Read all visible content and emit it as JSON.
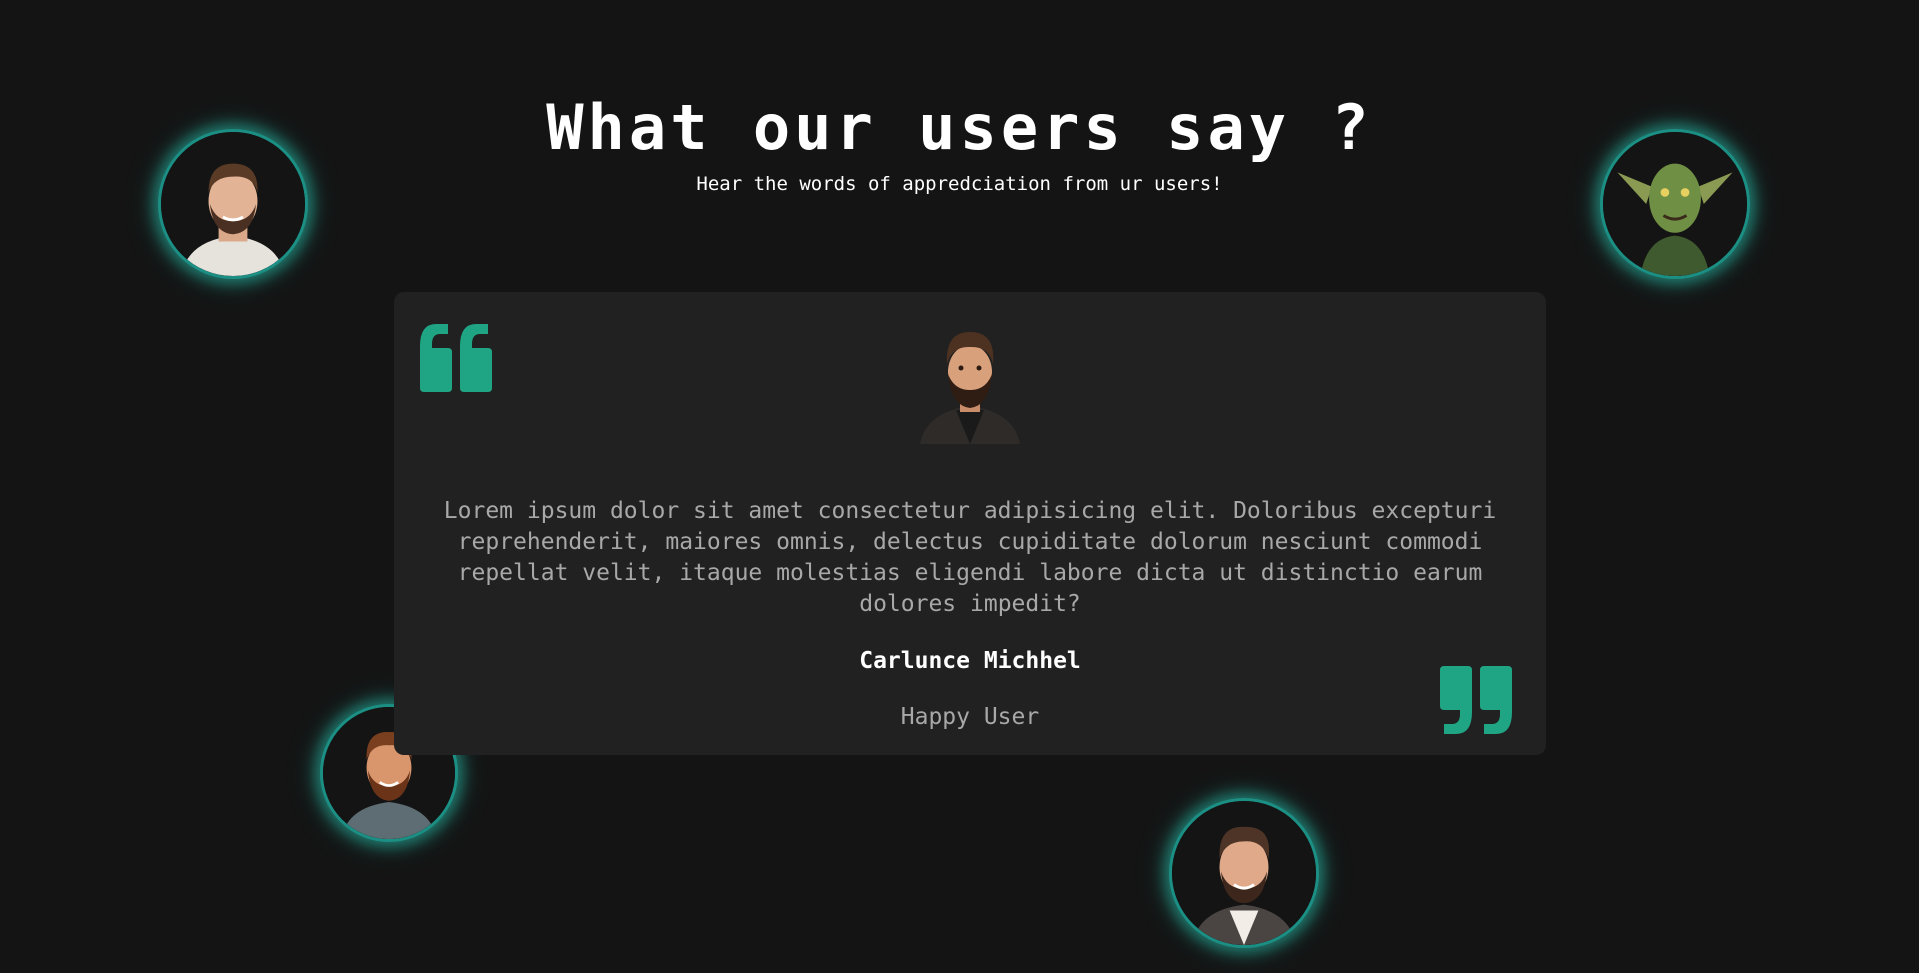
{
  "header": {
    "title": "What our users say ?",
    "subtitle": "Hear the words of appredciation from ur users!"
  },
  "testimonial": {
    "avatar": "bearded-man-avatar",
    "text": "Lorem ipsum dolor sit amet consectetur adipisicing elit. Doloribus excepturi reprehenderit, maiores omnis, delectus cupiditate dolorum nesciunt commodi repellat velit, itaque molestias eligendi labore dicta ut distinctio earum dolores impedit?",
    "name": "Carlunce Michhel",
    "role": "Happy User"
  },
  "user_avatars": [
    {
      "icon": "smiling-man-avatar"
    },
    {
      "icon": "goblin-avatar"
    },
    {
      "icon": "bearded-man-avatar"
    },
    {
      "icon": "smiling-man-jacket-avatar"
    }
  ],
  "colors": {
    "background": "#141414",
    "card": "#212121",
    "accent": "#1fa584",
    "glow": "#28beaa",
    "text_primary": "#ffffff",
    "text_secondary": "#a8a8a8"
  }
}
